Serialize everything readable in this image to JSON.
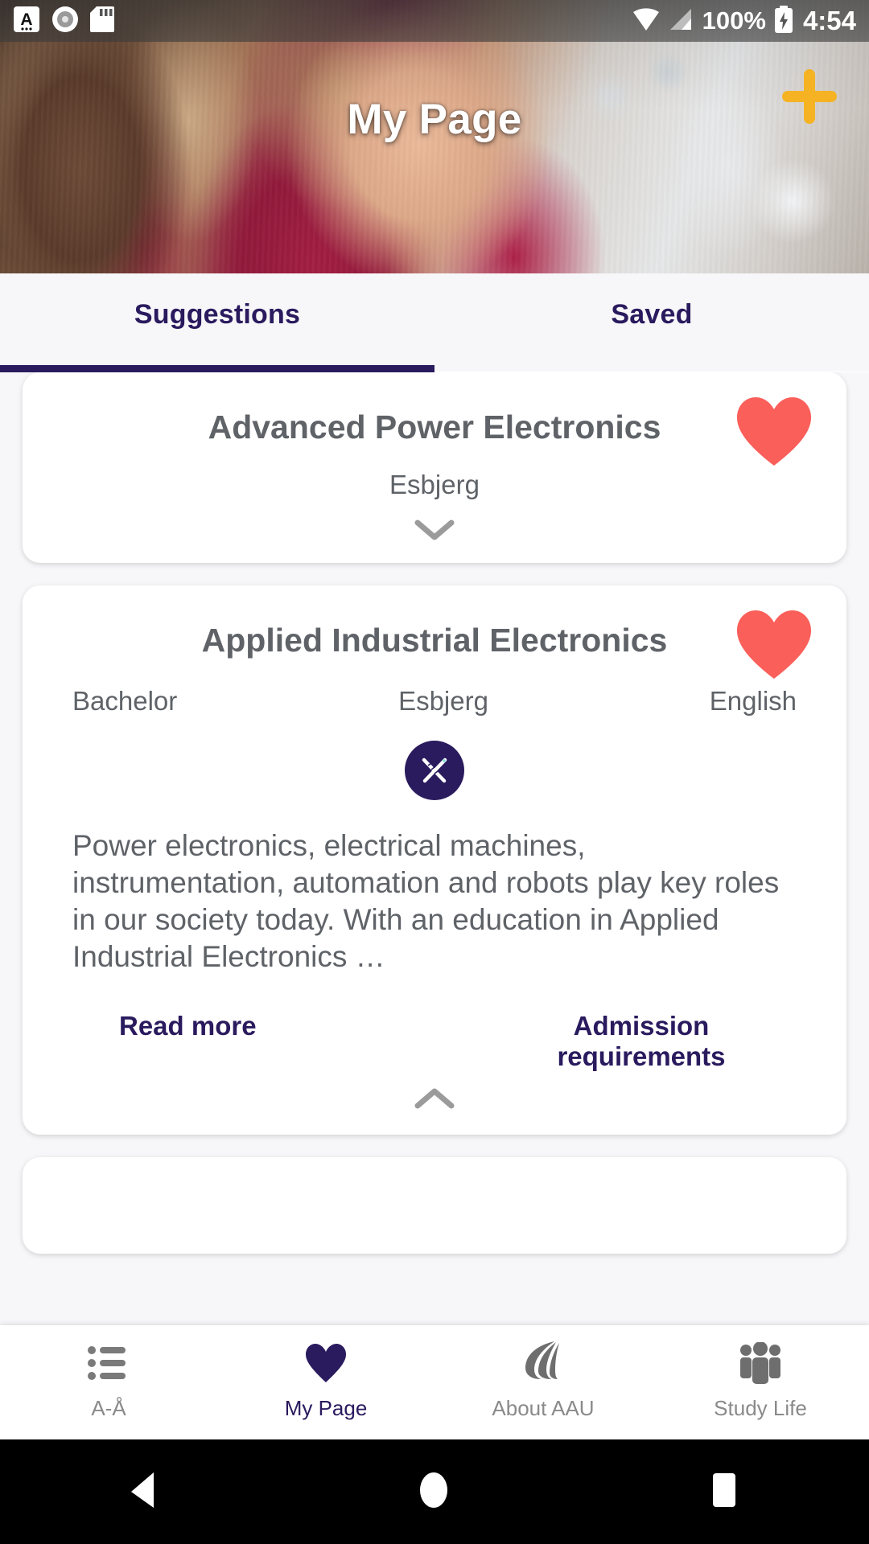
{
  "statusbar": {
    "icons": [
      "app-a-icon",
      "circle-record-icon",
      "sd-card-icon",
      "wifi-icon",
      "signal-icon"
    ],
    "battery_percent": "100%",
    "battery_icon": "battery-charging-icon",
    "time": "4:54"
  },
  "header": {
    "title": "My Page",
    "add_button": "add-icon",
    "accent_add_color": "#F5B324"
  },
  "tabs": {
    "items": [
      {
        "label": "Suggestions",
        "active": true
      },
      {
        "label": "Saved",
        "active": false
      }
    ],
    "indicator_color": "#2A1A5E"
  },
  "cards": [
    {
      "title": "Advanced Power Electronics",
      "favorite": true,
      "favorite_color": "#FA5F5A",
      "location": "Esbjerg",
      "expanded": false,
      "toggle_icon": "chevron-down-icon"
    },
    {
      "title": "Applied Industrial Electronics",
      "favorite": true,
      "favorite_color": "#FA5F5A",
      "degree": "Bachelor",
      "location": "Esbjerg",
      "language": "English",
      "badge_icon": "ruler-pencil-icon",
      "badge_color": "#2A1A5E",
      "description": "Power electronics, electrical machines, instrumentation, automation and robots play key roles in our society today. With an education in Applied Industrial Electronics …",
      "links": [
        {
          "label": "Read more"
        },
        {
          "label": "Admission requirements"
        }
      ],
      "expanded": true,
      "toggle_icon": "chevron-up-icon"
    }
  ],
  "bottomnav": {
    "items": [
      {
        "label": "A-Å",
        "icon": "list-icon",
        "active": false
      },
      {
        "label": "My Page",
        "icon": "heart-icon",
        "active": true
      },
      {
        "label": "About AAU",
        "icon": "aau-logo-icon",
        "active": false
      },
      {
        "label": "Study Life",
        "icon": "people-icon",
        "active": false
      }
    ],
    "active_color": "#2A1A5E",
    "inactive_color": "#7A7A7A"
  },
  "androidnav": {
    "back": "back-triangle-icon",
    "home": "home-circle-icon",
    "recents": "recents-square-icon"
  }
}
